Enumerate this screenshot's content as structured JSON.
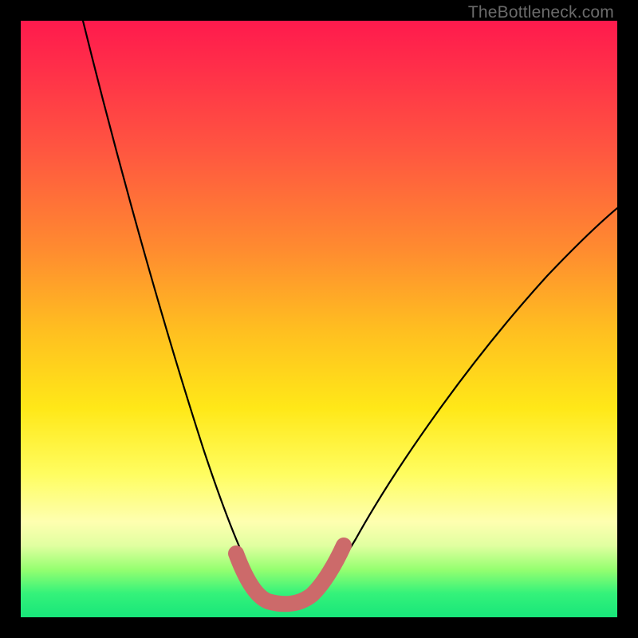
{
  "watermark": "TheBottleneck.com",
  "chart_data": {
    "type": "line",
    "title": "",
    "xlabel": "",
    "ylabel": "",
    "xlim": [
      0,
      100
    ],
    "ylim": [
      0,
      100
    ],
    "series": [
      {
        "name": "bottleneck-curve",
        "x": [
          10,
          14,
          18,
          22,
          26,
          30,
          33,
          35,
          37,
          38,
          40,
          42,
          44,
          46,
          48,
          50,
          54,
          60,
          70,
          80,
          90,
          100
        ],
        "values": [
          100,
          84,
          68,
          54,
          40,
          28,
          18,
          12,
          7,
          4,
          2,
          1,
          1,
          2,
          4,
          6,
          10,
          16,
          28,
          40,
          50,
          58
        ]
      },
      {
        "name": "highlight-band",
        "x": [
          35,
          37,
          39,
          41,
          43,
          45,
          47,
          49
        ],
        "values": [
          8,
          4,
          2,
          1,
          1,
          2,
          4,
          7
        ]
      }
    ],
    "colors": {
      "curve": "#000000",
      "highlight": "#cc6a6a",
      "gradient_top": "#ff1a4d",
      "gradient_mid": "#ffe818",
      "gradient_bottom": "#18e67a"
    }
  }
}
